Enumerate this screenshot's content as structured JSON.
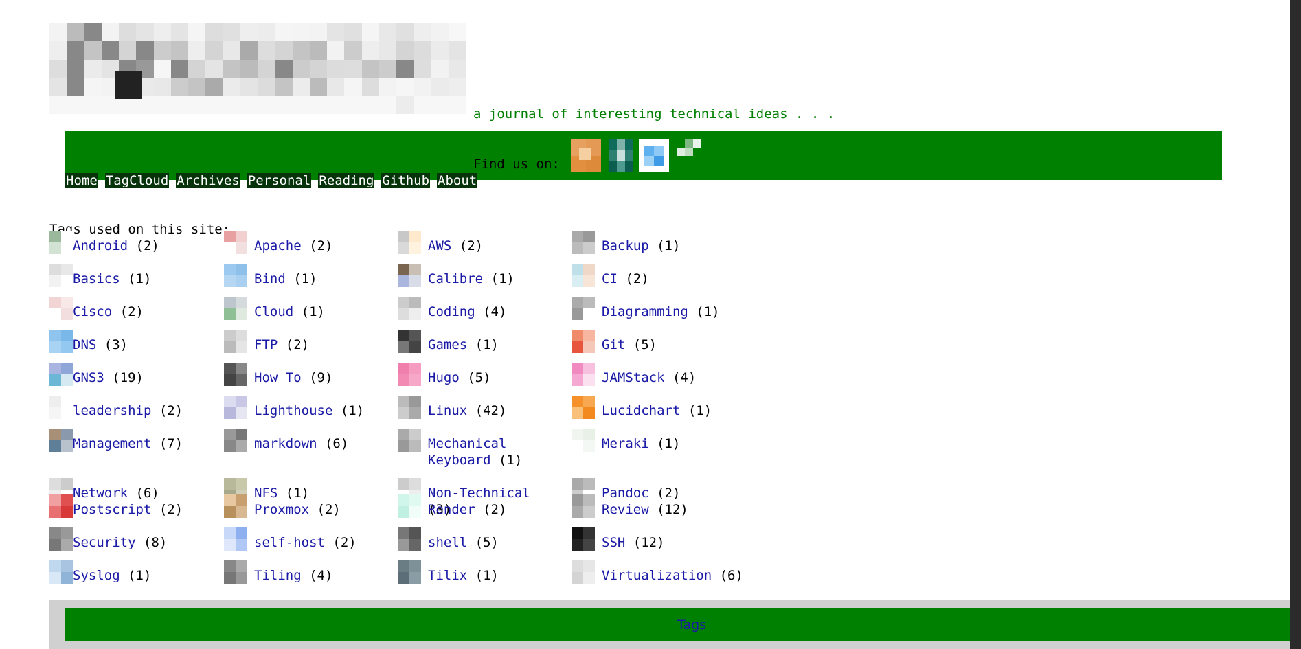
{
  "site": {
    "tagline": "a journal of interesting technical ideas . . .",
    "find_us": "Find us on:"
  },
  "colors": {
    "header_green": "#008000",
    "nav_bg": "#06330a",
    "link": "#1a1aa6",
    "footer_gray": "#d0d0d0"
  },
  "social_icons": [
    "rss-icon",
    "mastodon-icon",
    "twitter-icon",
    "github-icon"
  ],
  "nav": [
    "Home",
    "TagCloud",
    "Archives",
    "Personal",
    "Reading",
    "Github",
    "About"
  ],
  "tags_heading": "Tags used on this site:",
  "tags": [
    {
      "name": "Android",
      "count": "(2)"
    },
    {
      "name": "Apache",
      "count": "(2)"
    },
    {
      "name": "AWS",
      "count": "(2)"
    },
    {
      "name": "Backup",
      "count": "(1)"
    },
    {
      "name": "Basics",
      "count": "(1)"
    },
    {
      "name": "Bind",
      "count": "(1)"
    },
    {
      "name": "Calibre",
      "count": "(1)"
    },
    {
      "name": "CI",
      "count": "(2)"
    },
    {
      "name": "Cisco",
      "count": "(2)"
    },
    {
      "name": "Cloud",
      "count": "(1)"
    },
    {
      "name": "Coding",
      "count": "(4)"
    },
    {
      "name": "Diagramming",
      "count": "(1)"
    },
    {
      "name": "DNS",
      "count": "(3)"
    },
    {
      "name": "FTP",
      "count": "(2)"
    },
    {
      "name": "Games",
      "count": "(1)"
    },
    {
      "name": "Git",
      "count": "(5)"
    },
    {
      "name": "GNS3",
      "count": "(19)"
    },
    {
      "name": "How To",
      "count": "(9)"
    },
    {
      "name": "Hugo",
      "count": "(5)"
    },
    {
      "name": "JAMStack",
      "count": "(4)"
    },
    {
      "name": "leadership",
      "count": "(2)"
    },
    {
      "name": "Lighthouse",
      "count": "(1)"
    },
    {
      "name": "Linux",
      "count": "(42)"
    },
    {
      "name": "Lucidchart",
      "count": "(1)"
    },
    {
      "name": "Management",
      "count": "(7)"
    },
    {
      "name": "markdown",
      "count": "(6)"
    },
    {
      "name": "Mechanical Keyboard",
      "count": "(1)"
    },
    {
      "name": "Meraki",
      "count": "(1)"
    },
    {
      "name": "Network",
      "count": "(6)"
    },
    {
      "name": "NFS",
      "count": "(1)"
    },
    {
      "name": "Non-Technical",
      "count": "(3)"
    },
    {
      "name": "Pandoc",
      "count": "(2)"
    },
    {
      "name": "Postscript",
      "count": "(2)"
    },
    {
      "name": "Proxmox",
      "count": "(2)"
    },
    {
      "name": "Render",
      "count": "(2)"
    },
    {
      "name": "Review",
      "count": "(12)"
    },
    {
      "name": "Security",
      "count": "(8)"
    },
    {
      "name": "self-host",
      "count": "(2)"
    },
    {
      "name": "shell",
      "count": "(5)"
    },
    {
      "name": "SSH",
      "count": "(12)"
    },
    {
      "name": "Syslog",
      "count": "(1)"
    },
    {
      "name": "Tiling",
      "count": "(4)"
    },
    {
      "name": "Tilix",
      "count": "(1)"
    },
    {
      "name": "Virtualization",
      "count": "(6)"
    }
  ],
  "footer": {
    "link": "Tags"
  }
}
